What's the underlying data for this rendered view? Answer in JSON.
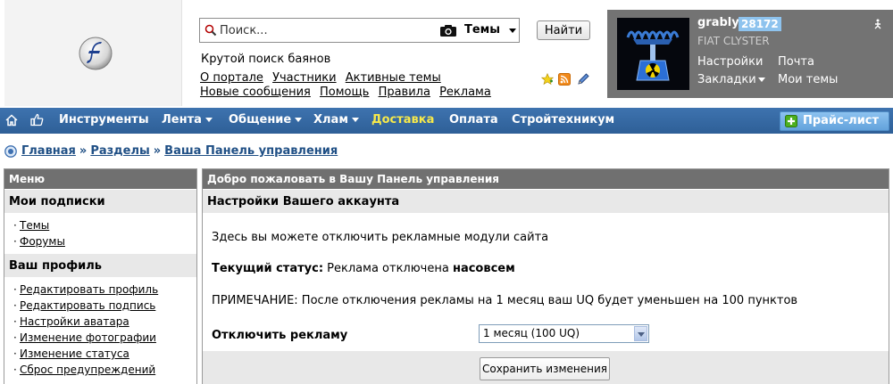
{
  "header": {
    "search": {
      "placeholder": "Поиск...",
      "scope": "Темы",
      "find_label": "Найти"
    },
    "tagline": "Крутой поиск баянов",
    "nav_row1": [
      "О портале",
      "Участники",
      "Активные темы"
    ],
    "nav_row2": [
      "Новые сообщения",
      "Помощь",
      "Правила",
      "Реклама"
    ]
  },
  "user": {
    "name": "grably",
    "uq": "28172",
    "car": "FIAT CLYSTER",
    "links": {
      "settings": "Настройки",
      "mail": "Почта",
      "bookmarks": "Закладки",
      "my_topics": "Мои темы"
    }
  },
  "menu": {
    "items": [
      "Инструменты",
      "Лента",
      "Общение",
      "Хлам",
      "Доставка",
      "Оплата",
      "Стройтехникум"
    ],
    "price_button": "Прайс-лист"
  },
  "breadcrumb": [
    "Главная",
    "Разделы",
    "Ваша Панель управления"
  ],
  "sidebar": {
    "title": "Меню",
    "sections": [
      {
        "title": "Мои подписки",
        "items": [
          "Темы",
          "Форумы"
        ]
      },
      {
        "title": "Ваш профиль",
        "items": [
          "Редактировать профиль",
          "Редактировать подпись",
          "Настройки аватара",
          "Изменение фотографии",
          "Изменение статуса",
          "Сброс предупреждений"
        ]
      }
    ]
  },
  "main": {
    "title": "Добро пожаловать в Вашу Панель управления",
    "subtitle": "Настройки Вашего аккаунта",
    "description": "Здесь вы можете отключить рекламные модули сайта",
    "status_label": "Текущий статус:",
    "status_value": "Реклама отключена",
    "status_emphasis": "насовсем",
    "note": "ПРИМЕЧАНИЕ: После отключения рекламы на 1 месяц ваш UQ будет уменьшен на 100 пунктов",
    "disable_label": "Отключить рекламу",
    "disable_option": "1 месяц (100 UQ)",
    "save_label": "Сохранить изменения"
  },
  "colors": {
    "menubar": "#3565a0",
    "delivery_highlight": "#f7e94a",
    "panel_header": "#707070",
    "section_bg": "#e8e8e8",
    "uq_badge": "#8ec3ee"
  }
}
